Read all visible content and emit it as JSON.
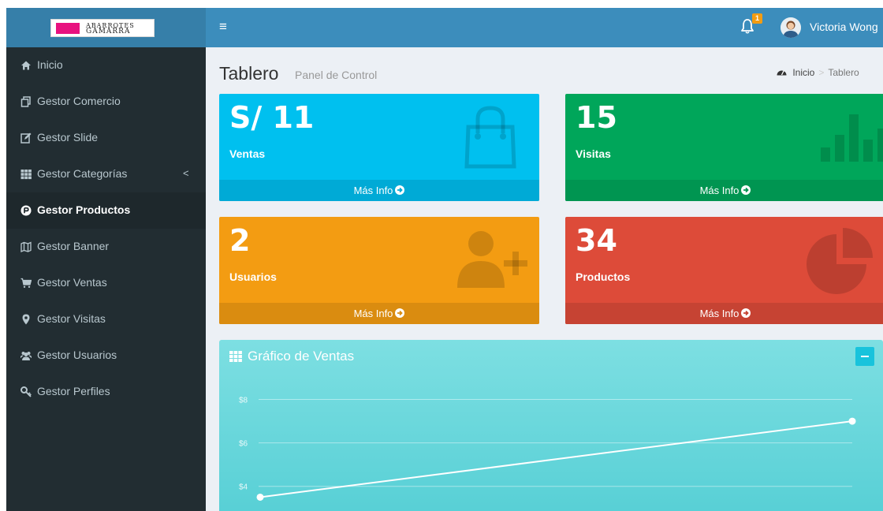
{
  "header": {
    "logo_line1": "ABARROTES",
    "logo_line2": "GAMARRA",
    "notification_count": "1",
    "user_name": "Victoria Wong"
  },
  "sidebar": {
    "items": [
      {
        "label": "Inicio",
        "icon": "home-icon"
      },
      {
        "label": "Gestor Comercio",
        "icon": "copy-icon"
      },
      {
        "label": "Gestor Slide",
        "icon": "edit-icon"
      },
      {
        "label": "Gestor Categorías",
        "icon": "th-icon",
        "has_arrow": true
      },
      {
        "label": "Gestor Productos",
        "icon": "product-hunt-icon",
        "active": true
      },
      {
        "label": "Gestor Banner",
        "icon": "map-icon"
      },
      {
        "label": "Gestor Ventas",
        "icon": "shopping-cart-icon"
      },
      {
        "label": "Gestor Visitas",
        "icon": "map-marker-icon"
      },
      {
        "label": "Gestor Usuarios",
        "icon": "users-icon"
      },
      {
        "label": "Gestor Perfiles",
        "icon": "key-icon"
      }
    ],
    "arrow": "<"
  },
  "content": {
    "title": "Tablero",
    "subtitle": "Panel de Control",
    "breadcrumb": {
      "home": "Inicio",
      "separator": ">",
      "current": "Tablero"
    }
  },
  "boxes": {
    "ventas": {
      "value": "S/ 11",
      "label": "Ventas",
      "footer": "Más Info",
      "color": "#00c0ef"
    },
    "visitas": {
      "value": "15",
      "label": "Visitas",
      "footer": "Más Info",
      "color": "#00a65a"
    },
    "usuarios": {
      "value": "2",
      "label": "Usuarios",
      "footer": "Más Info",
      "color": "#f39c12"
    },
    "productos": {
      "value": "34",
      "label": "Productos",
      "footer": "Más Info",
      "color": "#dd4b39"
    }
  },
  "chart_box": {
    "title": "Gráfico de Ventas"
  },
  "chart_data": {
    "type": "line",
    "title": "Gráfico de Ventas",
    "x": [
      0,
      1
    ],
    "series": [
      {
        "values": [
          3.5,
          7
        ]
      }
    ],
    "ytick_labels": [
      "$4",
      "$6",
      "$8"
    ],
    "ytick_values": [
      4,
      6,
      8
    ],
    "ylim": [
      2.5,
      9
    ],
    "grid": true,
    "line_color": "#ffffff"
  }
}
